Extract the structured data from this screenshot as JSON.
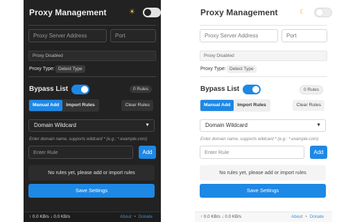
{
  "app": {
    "title": "Proxy Management",
    "theme_icon_dark": "☀",
    "theme_icon_light": "☾"
  },
  "proxy": {
    "address_placeholder": "Proxy Server Address",
    "port_placeholder": "Port",
    "status": "Proxy Disabled",
    "type_label": "Proxy Type:",
    "type_value": "Detect Type"
  },
  "bypass": {
    "title": "Bypass List",
    "enabled": true,
    "rules_count": "0 Rules",
    "tabs": [
      "Manual Add",
      "Import Rules"
    ],
    "active_tab": "Manual Add",
    "clear_label": "Clear Rules",
    "mode_selected": "Domain Wildcard",
    "hint": "Enter domain name, supports wildcard * (e.g.: *.example.com)",
    "rule_placeholder": "Enter Rule",
    "add_label": "Add",
    "empty_message": "No rules yet, please add or import rules",
    "save_label": "Save Settings"
  },
  "footer": {
    "traffic": "↑ 0.0 KB/s ↓ 0.0 KB/s",
    "about": "About",
    "separator": "•",
    "donate": "Donate"
  },
  "colors": {
    "accent": "#1e88e5",
    "dark_bg": "#222222",
    "light_bg": "#ffffff",
    "link": "#3b8fdc"
  },
  "icons": {
    "theme_dark": "sun-icon",
    "theme_light": "moon-icon",
    "select": "chevron-down-icon"
  }
}
